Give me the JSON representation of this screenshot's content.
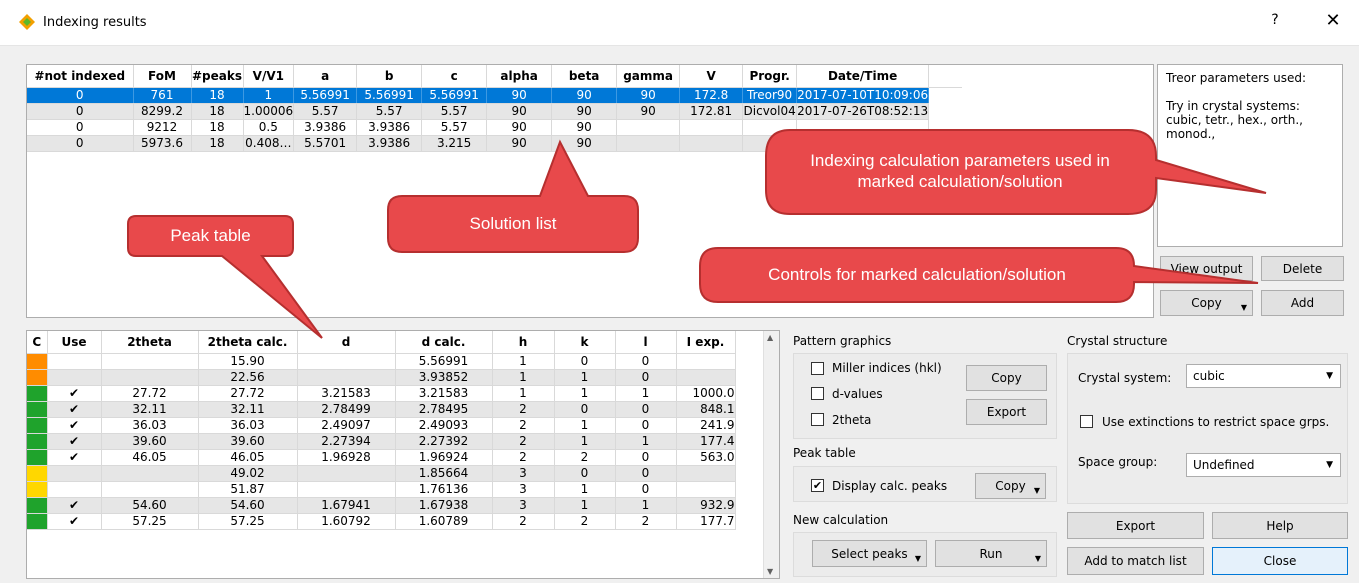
{
  "window": {
    "title": "Indexing results",
    "help": "?",
    "close": "✕"
  },
  "solutions": {
    "columns": [
      "#not indexed",
      "FoM",
      "#peaks",
      "V/V1",
      "a",
      "b",
      "c",
      "alpha",
      "beta",
      "gamma",
      "V",
      "Progr.",
      "Date/Time"
    ],
    "rows": [
      [
        "0",
        "761",
        "18",
        "1",
        "5.56991",
        "5.56991",
        "5.56991",
        "90",
        "90",
        "90",
        "172.8",
        "Treor90",
        "2017-07-10T10:09:06"
      ],
      [
        "0",
        "8299.2",
        "18",
        "1.00006",
        "5.57",
        "5.57",
        "5.57",
        "90",
        "90",
        "90",
        "172.81",
        "Dicvol04",
        "2017-07-26T08:52:13"
      ],
      [
        "0",
        "9212",
        "18",
        "0.5",
        "3.9386",
        "3.9386",
        "5.57",
        "90",
        "90",
        "",
        "",
        "",
        ""
      ],
      [
        "0",
        "5973.6",
        "18",
        "0.408…",
        "5.5701",
        "3.9386",
        "3.215",
        "90",
        "90",
        "",
        "",
        "",
        ""
      ]
    ]
  },
  "parameters": {
    "text": "Treor parameters used:\n\nTry in crystal systems:\ncubic, tetr., hex., orth.,\nmonod.,"
  },
  "buttons": {
    "view_output": "View output",
    "delete": "Delete",
    "copy": "Copy",
    "add": "Add"
  },
  "peaks": {
    "columns": [
      "C",
      "Use",
      "2theta",
      "2theta calc.",
      "d",
      "d calc.",
      "h",
      "k",
      "l",
      "I exp."
    ],
    "rows": [
      {
        "color": "#ff8c00",
        "use": "",
        "twotheta": "",
        "calc": "15.90",
        "d": "",
        "dcalc": "5.56991",
        "h": "1",
        "k": "0",
        "l": "0",
        "iexp": ""
      },
      {
        "color": "#ff8c00",
        "use": "",
        "twotheta": "",
        "calc": "22.56",
        "d": "",
        "dcalc": "3.93852",
        "h": "1",
        "k": "1",
        "l": "0",
        "iexp": ""
      },
      {
        "color": "#1fa32c",
        "use": "✔",
        "twotheta": "27.72",
        "calc": "27.72",
        "d": "3.21583",
        "dcalc": "3.21583",
        "h": "1",
        "k": "1",
        "l": "1",
        "iexp": "1000.0"
      },
      {
        "color": "#1fa32c",
        "use": "✔",
        "twotheta": "32.11",
        "calc": "32.11",
        "d": "2.78499",
        "dcalc": "2.78495",
        "h": "2",
        "k": "0",
        "l": "0",
        "iexp": "848.1"
      },
      {
        "color": "#1fa32c",
        "use": "✔",
        "twotheta": "36.03",
        "calc": "36.03",
        "d": "2.49097",
        "dcalc": "2.49093",
        "h": "2",
        "k": "1",
        "l": "0",
        "iexp": "241.9"
      },
      {
        "color": "#1fa32c",
        "use": "✔",
        "twotheta": "39.60",
        "calc": "39.60",
        "d": "2.27394",
        "dcalc": "2.27392",
        "h": "2",
        "k": "1",
        "l": "1",
        "iexp": "177.4"
      },
      {
        "color": "#1fa32c",
        "use": "✔",
        "twotheta": "46.05",
        "calc": "46.05",
        "d": "1.96928",
        "dcalc": "1.96924",
        "h": "2",
        "k": "2",
        "l": "0",
        "iexp": "563.0"
      },
      {
        "color": "#ffd700",
        "use": "",
        "twotheta": "",
        "calc": "49.02",
        "d": "",
        "dcalc": "1.85664",
        "h": "3",
        "k": "0",
        "l": "0",
        "iexp": ""
      },
      {
        "color": "#ffd700",
        "use": "",
        "twotheta": "",
        "calc": "51.87",
        "d": "",
        "dcalc": "1.76136",
        "h": "3",
        "k": "1",
        "l": "0",
        "iexp": ""
      },
      {
        "color": "#1fa32c",
        "use": "✔",
        "twotheta": "54.60",
        "calc": "54.60",
        "d": "1.67941",
        "dcalc": "1.67938",
        "h": "3",
        "k": "1",
        "l": "1",
        "iexp": "932.9"
      },
      {
        "color": "#1fa32c",
        "use": "✔",
        "twotheta": "57.25",
        "calc": "57.25",
        "d": "1.60792",
        "dcalc": "1.60789",
        "h": "2",
        "k": "2",
        "l": "2",
        "iexp": "177.7"
      }
    ]
  },
  "pattern_graphics": {
    "title": "Pattern graphics",
    "miller": "Miller indices (hkl)",
    "dvalues": "d-values",
    "twotheta": "2theta",
    "copy": "Copy",
    "export": "Export"
  },
  "peak_table": {
    "title": "Peak table",
    "display_calc": "Display calc. peaks",
    "display_calc_checked": "✔",
    "copy": "Copy"
  },
  "new_calc": {
    "title": "New calculation",
    "select_peaks": "Select peaks",
    "run": "Run"
  },
  "crystal": {
    "title": "Crystal structure",
    "system_label": "Crystal system:",
    "system_value": "cubic",
    "extinctions": "Use extinctions to restrict space grps.",
    "space_group_label": "Space group:",
    "space_group_value": "Undefined"
  },
  "bottom_buttons": {
    "export": "Export",
    "help": "Help",
    "add_match": "Add to match list",
    "close": "Close"
  },
  "callouts": {
    "peak_table": "Peak table",
    "solution_list": "Solution list",
    "params": "Indexing calculation parameters used in marked calculation/solution",
    "controls": "Controls for marked calculation/solution"
  },
  "colors": {
    "selection": "#0078d7",
    "callout_fill": "#e8494b",
    "callout_stroke": "#b62f2f"
  }
}
